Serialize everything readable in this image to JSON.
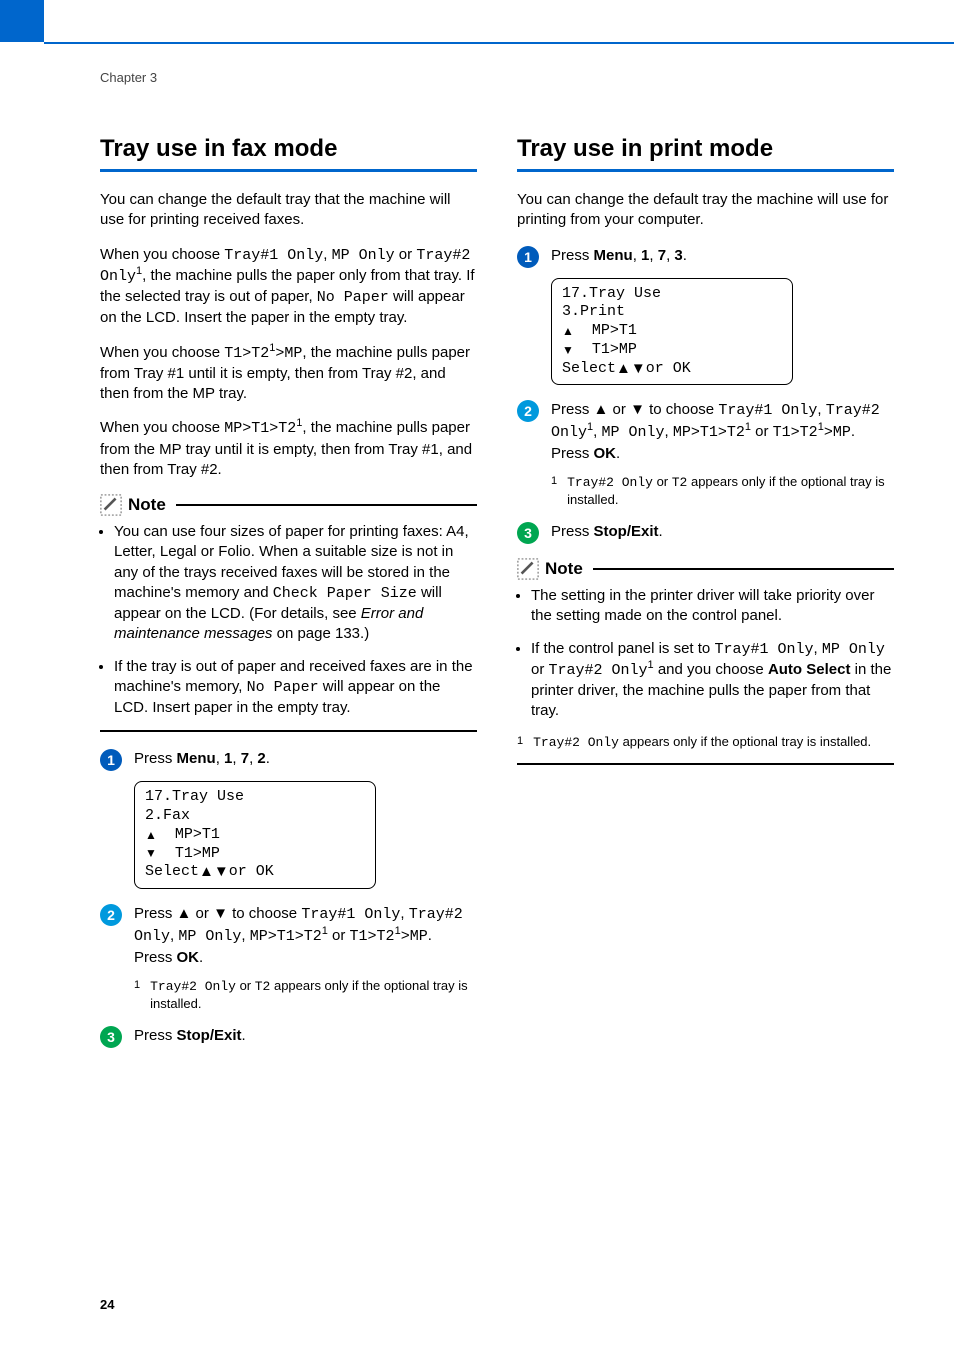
{
  "chapter": "Chapter 3",
  "page_number": "24",
  "left": {
    "title": "Tray use in fax mode",
    "intro": "You can change the default tray that the machine will use for printing received faxes.",
    "para2_a": "When you choose ",
    "para2_code1": "Tray#1 Only",
    "para2_b": ", ",
    "para2_code2": "MP Only",
    "para2_c": " or ",
    "para2_code3": "Tray#2 Only",
    "para2_d": ", the machine pulls the paper only from that tray. If the selected tray is out of paper, ",
    "para2_code4": "No Paper",
    "para2_e": " will appear on the LCD. Insert the paper in the empty tray.",
    "para3_a": "When you choose ",
    "para3_code1": "T1>T2",
    "para3_b": ">MP",
    "para3_c": ", the machine pulls paper from Tray #1 until it is empty, then from Tray #2, and then from the MP tray.",
    "para4_a": "When you choose ",
    "para4_code1": "MP>T1>T2",
    "para4_b": ", the machine pulls paper from the MP tray until it is empty, then from Tray #1, and then from Tray #2.",
    "note_label": "Note",
    "note1_a": "You can use four sizes of paper for printing faxes: A4, Letter, Legal or Folio. When a suitable size is not in any of the trays received faxes will be stored in the machine's memory and ",
    "note1_code": "Check Paper Size",
    "note1_b": " will appear on the LCD. (For details, see ",
    "note1_em": "Error and maintenance messages",
    "note1_c": " on page 133.)",
    "note2_a": "If the tray is out of paper and received faxes are in the machine's memory, ",
    "note2_code": "No Paper",
    "note2_b": " will appear on the LCD. Insert paper in the empty tray.",
    "step1_a": "Press ",
    "step1_b": "Menu",
    "step1_c": ", ",
    "step1_d": "1",
    "step1_e": ", ",
    "step1_f": "7",
    "step1_g": ", ",
    "step1_h": "2",
    "step1_i": ".",
    "lcd": {
      "l1": "17.Tray Use",
      "l2": "  2.Fax",
      "l3": "MP>T1",
      "l4": "T1>MP",
      "l5a": "Select ",
      "l5b": " or OK"
    },
    "step2_a": "Press ",
    "step2_b": " or ",
    "step2_c": " to choose ",
    "step2_code1": "Tray#1 Only",
    "step2_d": ", ",
    "step2_code2": "Tray#2 Only",
    "step2_e": ", ",
    "step2_code3": "MP Only",
    "step2_f": ", ",
    "step2_code4": "MP>T1>T2",
    "step2_g": " or ",
    "step2_code5": "T1>T2",
    "step2_h": ">MP",
    "step2_i": ".",
    "step2_press": "Press ",
    "step2_ok": "OK",
    "step2_dot": ".",
    "fn1_num": "1",
    "fn1_a": "Tray#2 Only",
    "fn1_b": " or ",
    "fn1_c": "T2",
    "fn1_d": " appears only if the optional tray is installed.",
    "step3_a": "Press ",
    "step3_b": "Stop/Exit",
    "step3_c": "."
  },
  "right": {
    "title": "Tray use in print mode",
    "intro": "You can change the default tray the machine will use for printing from your computer.",
    "step1_a": "Press ",
    "step1_b": "Menu",
    "step1_c": ", ",
    "step1_d": "1",
    "step1_e": ", ",
    "step1_f": "7",
    "step1_g": ", ",
    "step1_h": "3",
    "step1_i": ".",
    "lcd": {
      "l1": "17.Tray Use",
      "l2": "  3.Print",
      "l3": "MP>T1",
      "l4": "T1>MP",
      "l5a": "Select ",
      "l5b": " or OK"
    },
    "step2_a": "Press ",
    "step2_b": " or ",
    "step2_c": " to choose ",
    "step2_code1": "Tray#1 Only",
    "step2_d": ", ",
    "step2_code2": "Tray#2 Only",
    "step2_e": ", ",
    "step2_code3": "MP Only",
    "step2_f": ", ",
    "step2_code4": "MP>T1>T2",
    "step2_g": " or ",
    "step2_code5": "T1>T2",
    "step2_h": ">MP",
    "step2_i": ".",
    "step2_press": "Press ",
    "step2_ok": "OK",
    "step2_dot": ".",
    "fn1_num": "1",
    "fn1_a": "Tray#2 Only",
    "fn1_b": " or ",
    "fn1_c": "T2",
    "fn1_d": " appears only if the optional tray is installed.",
    "step3_a": "Press ",
    "step3_b": "Stop/Exit",
    "step3_c": ".",
    "note_label": "Note",
    "note1": "The setting in the printer driver will take priority over the setting made on the control panel.",
    "note2_a": "If the control panel is set to ",
    "note2_code1": "Tray#1 Only",
    "note2_b": ", ",
    "note2_code2": "MP Only",
    "note2_c": " or ",
    "note2_code3": "Tray#2 Only",
    "note2_d": " and you choose ",
    "note2_strong": "Auto Select",
    "note2_e": " in the printer driver, the machine pulls the paper from that tray.",
    "fn2_num": "1",
    "fn2_a": "Tray#2 Only",
    "fn2_b": " appears only if the optional tray is installed."
  }
}
